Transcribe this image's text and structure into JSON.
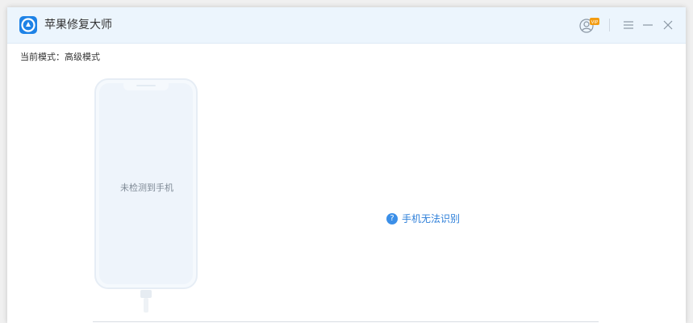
{
  "app": {
    "title": "苹果修复大师",
    "badge": "VIP"
  },
  "mode": {
    "label": "当前模式：高级模式"
  },
  "device": {
    "status": "未检测到手机"
  },
  "help": {
    "icon_char": "?",
    "label": "手机无法识别"
  },
  "colors": {
    "accent": "#1e82e6",
    "titlebar_bg": "#ecf5fd",
    "link": "#2e7fd9"
  },
  "icons": {
    "logo": "app-logo-icon",
    "user": "user-account-icon",
    "menu": "menu-icon",
    "minimize": "minimize-icon",
    "close": "close-icon"
  }
}
